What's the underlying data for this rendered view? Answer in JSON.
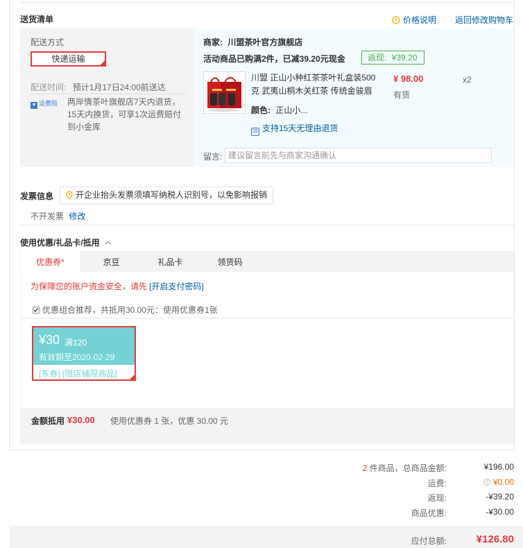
{
  "delivery": {
    "title": "送货清单",
    "price_help_label": "价格说明",
    "back_to_cart": "返回修改购物车",
    "ship_method_title": "配送方式",
    "ship_method_value": "快递运输",
    "ship_time_label": "配送时间:",
    "ship_time_value": "预计1月17日24:00前送达",
    "insurance_badge": "运费险",
    "insurance_text": "两岸情茶叶旗舰店7天内退货，15天内换货，可享1次运费赔付到小金库"
  },
  "order": {
    "merchant_label": "商家:",
    "merchant_name": "川盟茶叶官方旗舰店",
    "promo_text": "活动商品已购满2件，已减39.20元现金",
    "rebate_label": "返现:",
    "rebate_value": "¥39.20",
    "product_name": "川盟 正山小种红茶茶叶礼盒装500克 武夷山桐木关红茶 传统金骏眉",
    "product_price": "¥ 98.00",
    "product_qty": "x2",
    "stock_status": "有货",
    "color_label": "颜色:",
    "color_value": "正山小...",
    "return_policy": "支持15天无理由退货",
    "note_label": "留言:",
    "note_placeholder": "建议留言前先与商家沟通确认"
  },
  "invoice": {
    "title": "发票信息",
    "tip": "开企业抬头发票须填写纳税人识别号，以免影响报销",
    "value": "不开发票",
    "edit_label": "修改"
  },
  "coupons": {
    "title": "使用优惠/礼品卡/抵用",
    "tabs": [
      {
        "label": "优惠券*"
      },
      {
        "label": "京豆"
      },
      {
        "label": "礼品卡"
      },
      {
        "label": "领货码"
      }
    ],
    "security_warning": "为保障您的账户资金安全，请先",
    "security_link": "[开启支付密码]",
    "recommend_text": "优惠组合推荐，共抵用30.00元：使用优惠券1张",
    "card": {
      "amount": "¥30",
      "condition": "满120",
      "validity": "有效期至2020-02-29",
      "tag1": "[东券]",
      "tag2": "[限店铺限商品]"
    },
    "summary_label": "金额抵用",
    "summary_amount": "¥30.00",
    "summary_detail": "使用优惠券 1 张，优惠 30.00 元"
  },
  "totals": {
    "item_count": "2",
    "item_count_suffix": "件商品，总商品金额:",
    "goods_amount": "¥196.00",
    "freight_label": "运费:",
    "freight_value": "¥0.00",
    "rebate_label": "返现:",
    "rebate_value": "-¥39.20",
    "discount_label": "商品优惠:",
    "discount_value": "-¥30.00",
    "payable_label": "应付总额:",
    "payable_value": "¥126.80"
  },
  "colors": {
    "accent_red": "#e4393c",
    "link_blue": "#005ea7",
    "rebate_green": "#4bad4b",
    "coupon_teal": "#74d2d4",
    "freight_orange": "#f56a00"
  },
  "icons": [
    "info-circle-icon",
    "insurance-icon",
    "return-policy-icon",
    "location-pin-icon",
    "chevron-up-icon",
    "checkbox-icon",
    "corner-check-icon"
  ]
}
